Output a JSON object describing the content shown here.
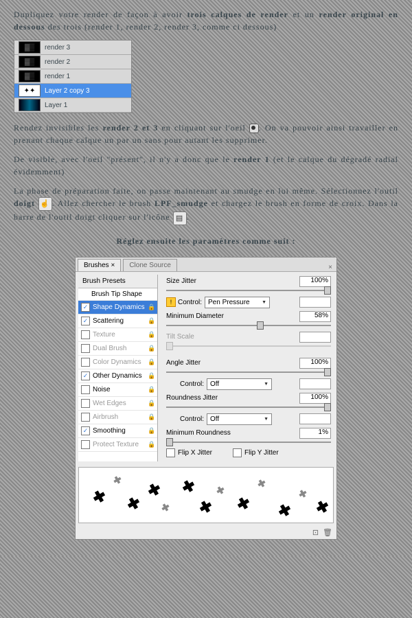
{
  "para1_a": "Dupliquez votre render de façon à avoir ",
  "para1_b": "trois calques de render",
  "para1_c": " et un ",
  "para1_d": "render original en dessous",
  "para1_e": " des trois (render 1, render 2, render 3, comme ci dessous)",
  "layers": {
    "r3": "render 3",
    "r2": "render 2",
    "r1": "render 1",
    "copy": "Layer 2 copy 3",
    "l1": "Layer 1"
  },
  "para2_a": "Rendez invisibles les ",
  "para2_b": "render 2 et 3",
  "para2_c": " en cliquant sur l'oeil",
  "para2_d": ". On va pouvoir ainsi travailler en prenant chaque calque un par un sans pour autant les supprimer.",
  "para3_a": "De visible, avec l'oeil \"présent\", il n'y a donc que le ",
  "para3_b": "render 1",
  "para3_c": " (et le calque du dégradé radial évidemment)",
  "para4_a": "La phase de préparation faite, on passe maintenant au smudge en lui même. Sélectionnez l'outil ",
  "para4_b": "doigt",
  "para4_c": ". Allez chercher le brush ",
  "para4_d": "LPF_smudge",
  "para4_e": " et chargez le brush en forme de croix. Dans la barre de l'outil doigt cliquer sur l'icône ",
  "para5": "Réglez ensuite les paramètres comme suit :",
  "panel": {
    "tab1": "Brushes ×",
    "tab2": "Clone Source",
    "presets": "Brush Presets",
    "tip": "Brush Tip Shape",
    "shape": "Shape Dynamics",
    "scatter": "Scattering",
    "texture": "Texture",
    "dual": "Dual Brush",
    "colord": "Color Dynamics",
    "otherd": "Other Dynamics",
    "noise": "Noise",
    "wet": "Wet Edges",
    "air": "Airbrush",
    "smooth": "Smoothing",
    "protect": "Protect Texture",
    "sizejit": "Size Jitter",
    "v100": "100%",
    "control": "Control:",
    "pen": "Pen Pressure",
    "off": "Off",
    "mindia": "Minimum Diameter",
    "v58": "58%",
    "tilt": "Tilt Scale",
    "anglejit": "Angle Jitter",
    "roundjit": "Roundness Jitter",
    "minround": "Minimum Roundness",
    "v1": "1%",
    "flipx": "Flip X Jitter",
    "flipy": "Flip Y Jitter"
  }
}
